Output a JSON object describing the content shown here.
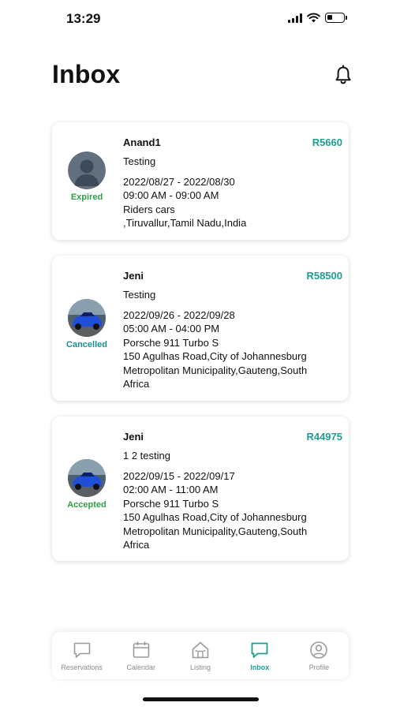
{
  "status_bar": {
    "time": "13:29"
  },
  "header": {
    "title": "Inbox",
    "bell_icon": "bell-icon"
  },
  "colors": {
    "accent": "#1e9e92",
    "expired": "#2f9e49",
    "cancelled": "#188e8e",
    "accepted": "#2f9e49"
  },
  "messages": [
    {
      "name": "Anand1",
      "price": "R5660",
      "status": "Expired",
      "message": "Testing",
      "dates": "2022/08/27 - 2022/08/30",
      "times": "09:00 AM - 09:00 AM",
      "vehicle": "Riders cars",
      "address_lines": [
        ",Tiruvallur,Tamil Nadu,India"
      ]
    },
    {
      "name": "Jeni",
      "price": "R58500",
      "status": "Cancelled",
      "message": "Testing",
      "dates": "2022/09/26 - 2022/09/28",
      "times": "05:00 AM - 04:00 PM",
      "vehicle": "Porsche 911 Turbo S",
      "address_lines": [
        "150 Agulhas Road,City of Johannesburg",
        "Metropolitan Municipality,Gauteng,South",
        "Africa"
      ]
    },
    {
      "name": "Jeni",
      "price": "R44975",
      "status": "Accepted",
      "message": "1 2 testing",
      "dates": "2022/09/15 - 2022/09/17",
      "times": "02:00 AM - 11:00 AM",
      "vehicle": "Porsche 911 Turbo S",
      "address_lines": [
        "150 Agulhas Road,City of Johannesburg",
        "Metropolitan Municipality,Gauteng,South",
        "Africa"
      ]
    }
  ],
  "tabs": [
    {
      "label": "Reservations",
      "icon": "chat-bubble-icon"
    },
    {
      "label": "Calendar",
      "icon": "calendar-icon"
    },
    {
      "label": "Listing",
      "icon": "house-icon"
    },
    {
      "label": "Inbox",
      "icon": "chat-bubble-icon",
      "active": true
    },
    {
      "label": "Profile",
      "icon": "user-circle-icon"
    }
  ]
}
